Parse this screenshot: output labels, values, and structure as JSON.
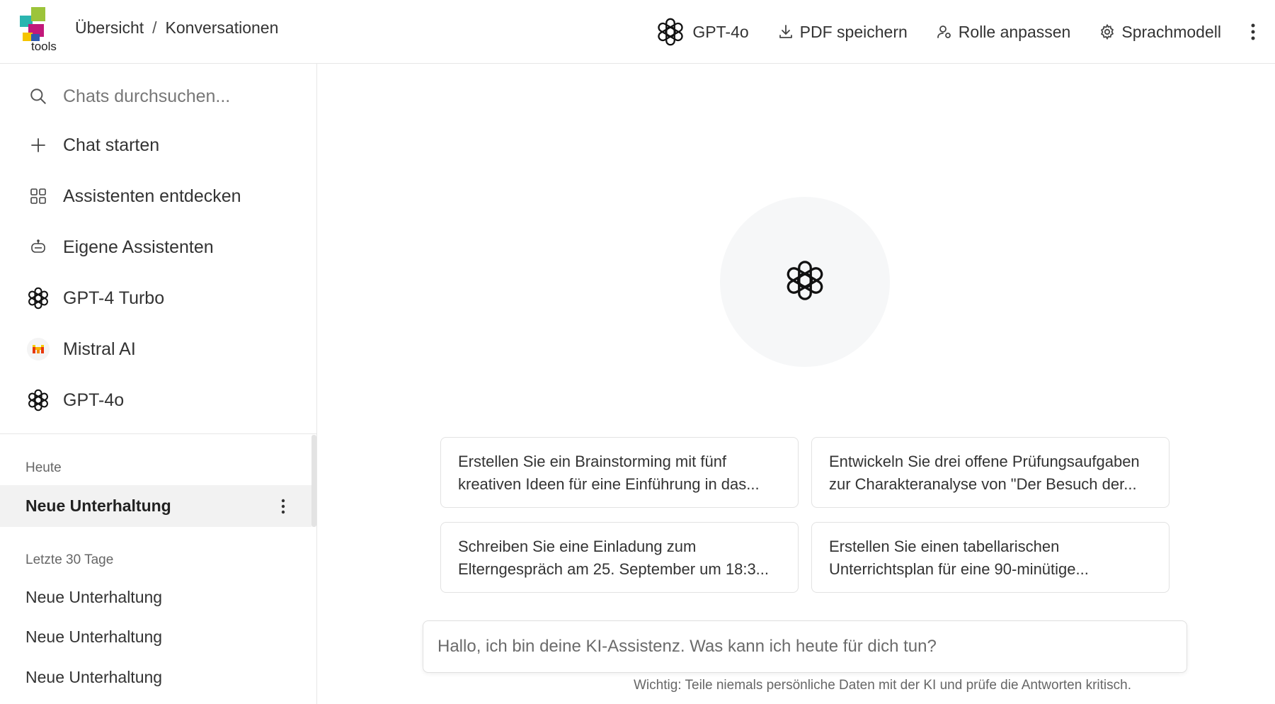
{
  "header": {
    "logo_text": "tools",
    "breadcrumb": [
      "Übersicht",
      "Konversationen"
    ],
    "breadcrumb_sep": "/",
    "model_label": "GPT-4o",
    "actions": {
      "pdf": "PDF speichern",
      "role": "Rolle anpassen",
      "model": "Sprachmodell"
    }
  },
  "sidebar": {
    "search_placeholder": "Chats durchsuchen...",
    "items": [
      {
        "label": "Chat starten",
        "icon": "plus-icon"
      },
      {
        "label": "Assistenten entdecken",
        "icon": "grid-icon"
      },
      {
        "label": "Eigene Assistenten",
        "icon": "robot-icon"
      },
      {
        "label": "GPT-4 Turbo",
        "icon": "openai-icon"
      },
      {
        "label": "Mistral AI",
        "icon": "mistral-icon"
      },
      {
        "label": "GPT-4o",
        "icon": "openai-icon"
      }
    ],
    "groups": {
      "today": "Heute",
      "last30": "Letzte 30 Tage"
    },
    "active_conversation": "Neue Unterhaltung",
    "conversations": [
      "Neue Unterhaltung",
      "Neue Unterhaltung",
      "Neue Unterhaltung"
    ]
  },
  "main": {
    "suggestions": [
      {
        "line1": "Erstellen Sie ein Brainstorming mit fünf",
        "line2": "kreativen Ideen für eine Einführung in das..."
      },
      {
        "line1": "Entwickeln Sie drei offene Prüfungsaufgaben",
        "line2": "zur Charakteranalyse von \"Der Besuch der..."
      },
      {
        "line1": "Schreiben Sie eine Einladung zum",
        "line2": "Elterngespräch am 25. September um 18:3..."
      },
      {
        "line1": "Erstellen Sie einen tabellarischen",
        "line2": "Unterrichtsplan für eine 90-minütige..."
      }
    ],
    "composer_placeholder": "Hallo, ich bin deine KI-Assistenz. Was kann ich heute für dich tun?",
    "disclaimer": "Wichtig: Teile niemals persönliche Daten mit der KI und prüfe die Antworten kritisch."
  },
  "colors": {
    "logo_teal": "#2bb5b0",
    "logo_green": "#9cc43a",
    "logo_magenta": "#c2187a",
    "logo_yellow": "#f5c400",
    "logo_blue": "#2f5bb0",
    "hero_bg": "#f6f7f8",
    "active_row_bg": "#f2f2f2"
  }
}
